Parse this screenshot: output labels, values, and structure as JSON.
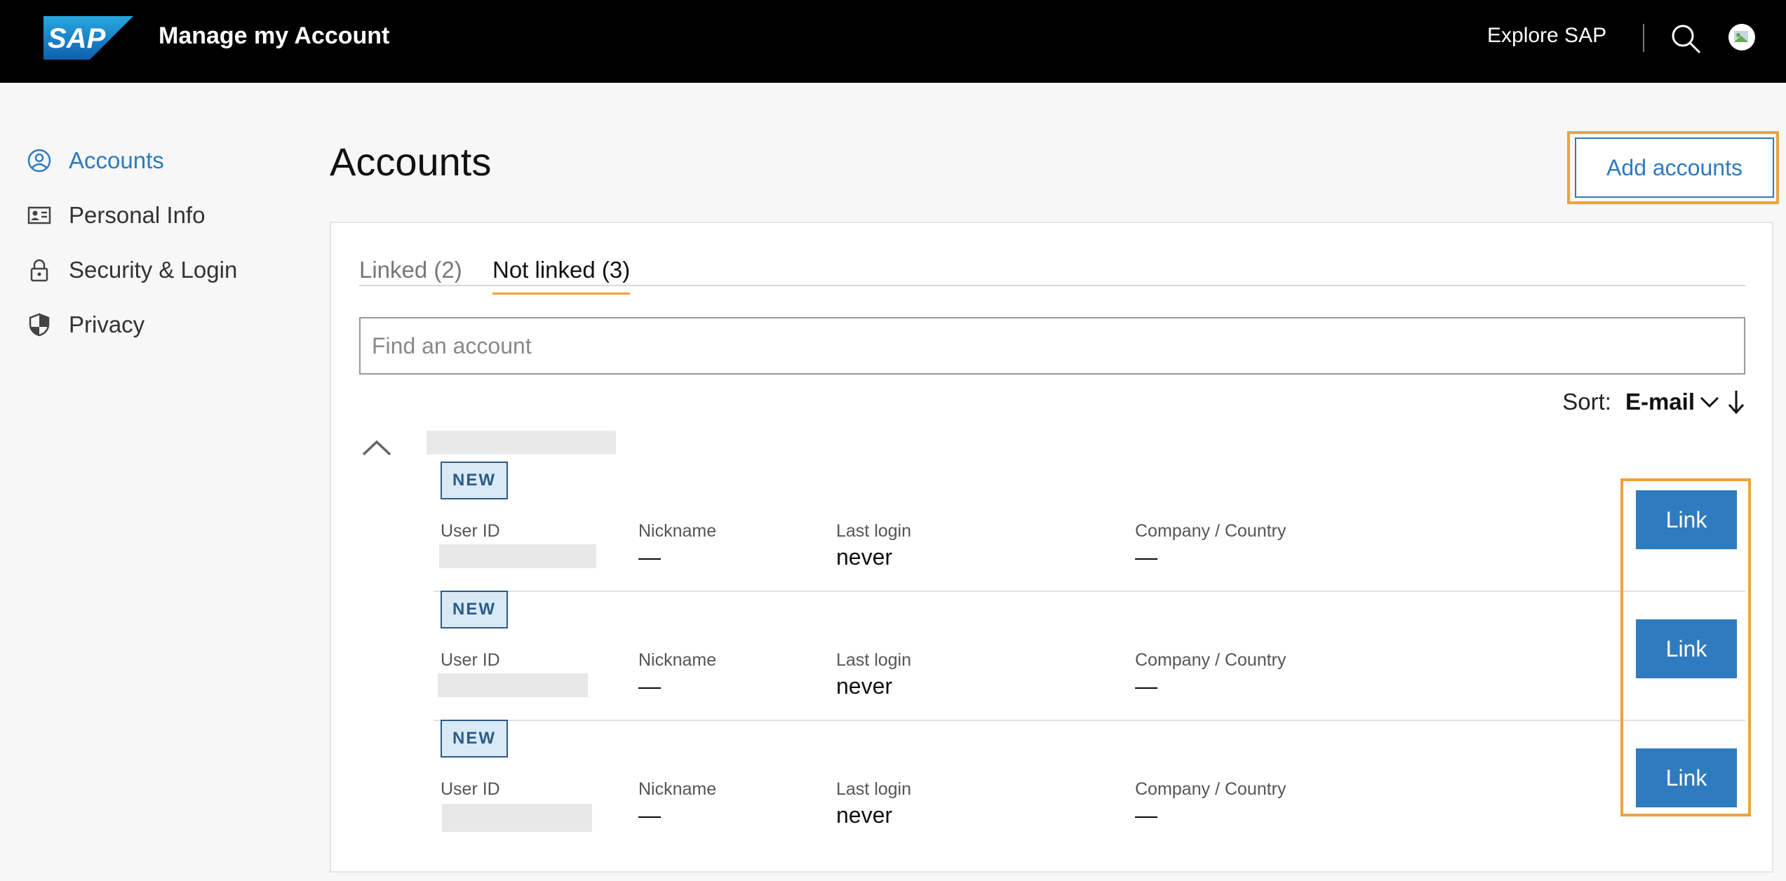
{
  "header": {
    "logo_text": "SAP",
    "app_title": "Manage my Account",
    "explore_label": "Explore SAP"
  },
  "sidebar": {
    "items": [
      {
        "label": "Accounts",
        "icon": "user-circle-icon",
        "active": true
      },
      {
        "label": "Personal Info",
        "icon": "id-card-icon",
        "active": false
      },
      {
        "label": "Security & Login",
        "icon": "lock-icon",
        "active": false
      },
      {
        "label": "Privacy",
        "icon": "shield-icon",
        "active": false
      }
    ]
  },
  "main": {
    "title": "Accounts",
    "add_button": "Add accounts",
    "tabs": [
      {
        "label": "Linked (2)",
        "active": false
      },
      {
        "label": "Not linked (3)",
        "active": true
      }
    ],
    "search": {
      "placeholder": "Find an account",
      "value": ""
    },
    "sort": {
      "label": "Sort:",
      "value": "E-mail",
      "direction": "descending"
    },
    "columns": {
      "user_id": "User ID",
      "nickname": "Nickname",
      "last_login": "Last login",
      "company": "Company / Country"
    },
    "accounts": [
      {
        "badge": "NEW",
        "nickname": "—",
        "last_login": "never",
        "company": "—",
        "action": "Link"
      },
      {
        "badge": "NEW",
        "nickname": "—",
        "last_login": "never",
        "company": "—",
        "action": "Link"
      },
      {
        "badge": "NEW",
        "nickname": "—",
        "last_login": "never",
        "company": "—",
        "action": "Link"
      }
    ]
  },
  "colors": {
    "accent": "#2e7abf",
    "highlight": "#f0a13c",
    "header_bg": "#000000",
    "badge_bg": "#d9e9f6"
  }
}
